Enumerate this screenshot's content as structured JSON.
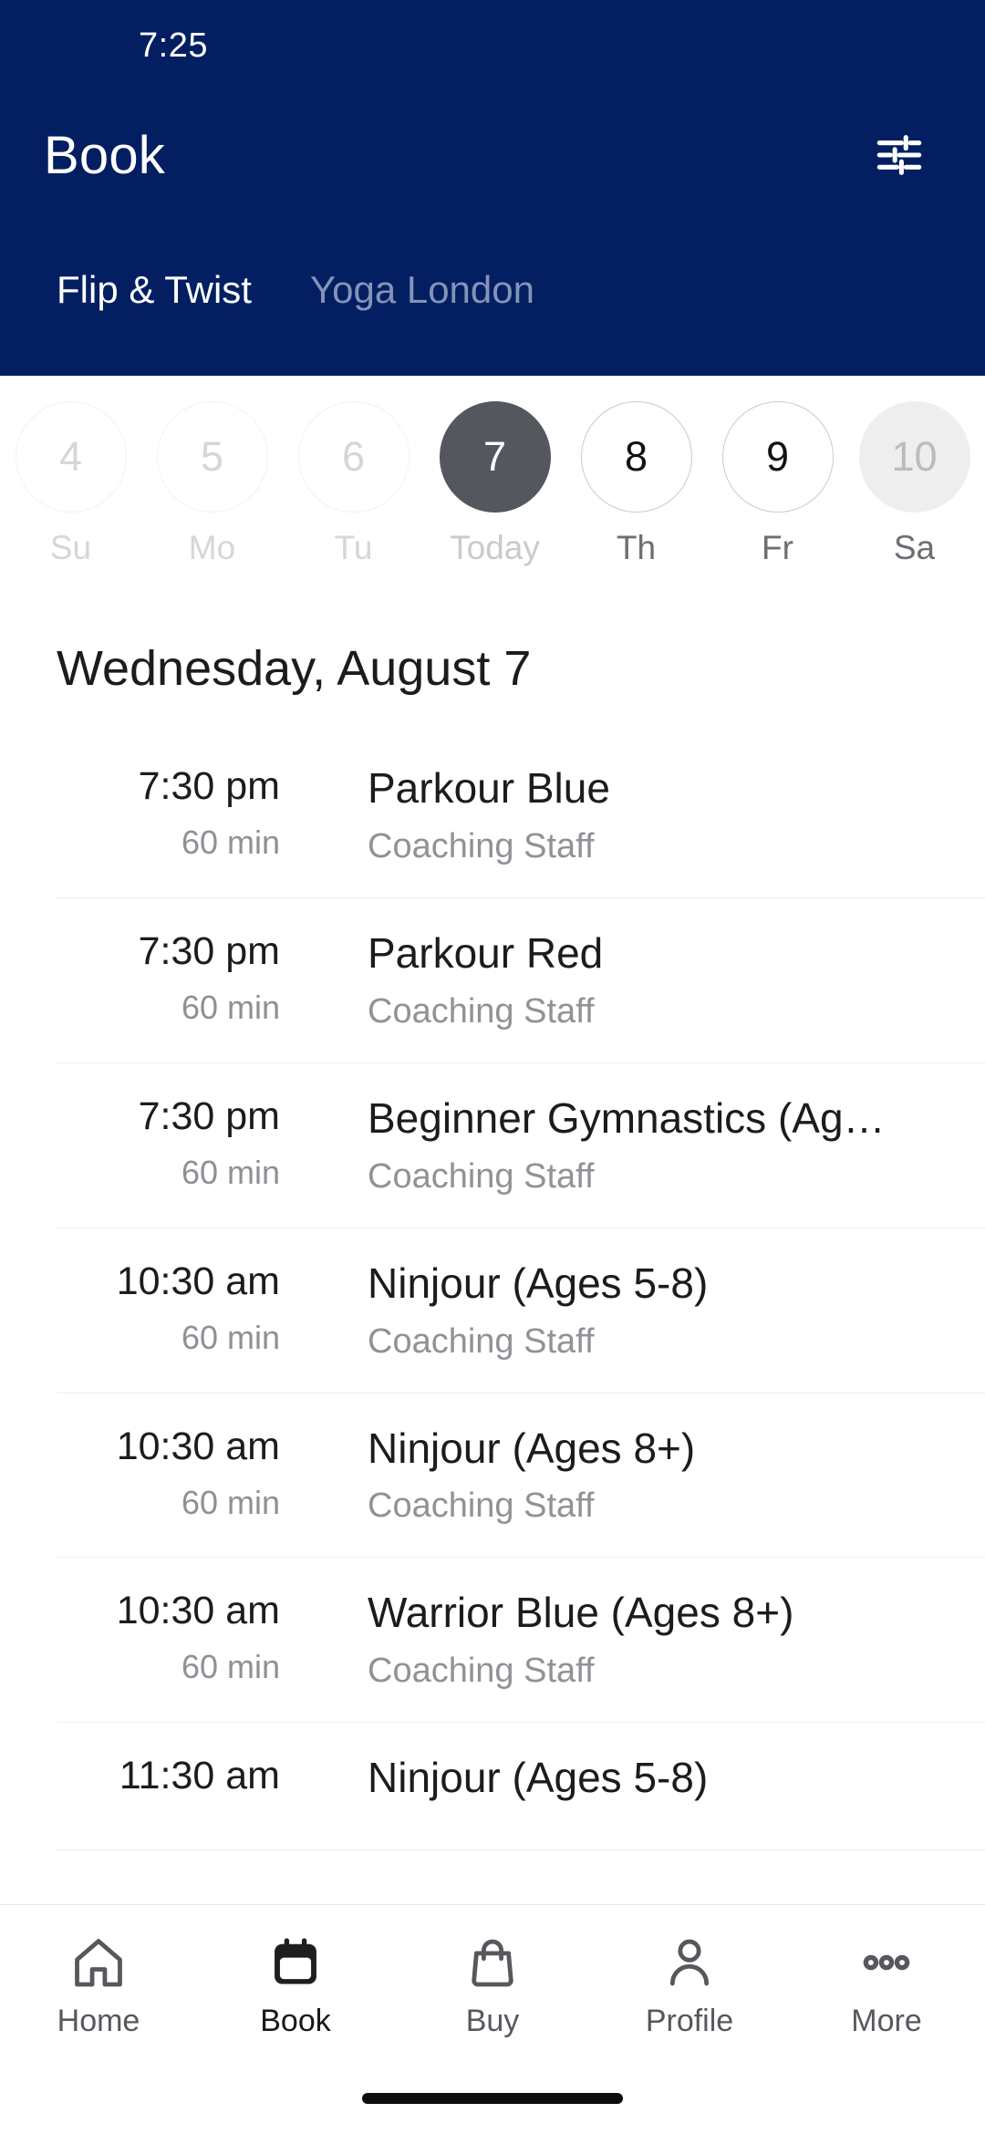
{
  "status_bar": {
    "time": "7:25"
  },
  "header": {
    "title": "Book",
    "filter_icon": "sliders-filter-icon",
    "tabs": [
      {
        "label": "Flip & Twist",
        "active": true
      },
      {
        "label": "Yoga London",
        "active": false
      }
    ],
    "background_color": "#031F62",
    "active_tab_color": "#FFFFFF",
    "inactive_tab_color": "#8493B8"
  },
  "date_strip": {
    "days": [
      {
        "date": "4",
        "weekday": "Su",
        "state": "disabled"
      },
      {
        "date": "5",
        "weekday": "Mo",
        "state": "disabled"
      },
      {
        "date": "6",
        "weekday": "Tu",
        "state": "disabled"
      },
      {
        "date": "7",
        "weekday": "Today",
        "state": "today"
      },
      {
        "date": "8",
        "weekday": "Th",
        "state": "selectable"
      },
      {
        "date": "9",
        "weekday": "Fr",
        "state": "selectable"
      },
      {
        "date": "10",
        "weekday": "Sa",
        "state": "weekend"
      }
    ],
    "today_circle_color": "#55575F",
    "weekend_circle_color": "#EEEEEF"
  },
  "schedule": {
    "date_heading": "Wednesday, August 7",
    "classes": [
      {
        "time": "7:30 pm",
        "duration": "60 min",
        "title": "Parkour Blue",
        "instructor": "Coaching Staff"
      },
      {
        "time": "7:30 pm",
        "duration": "60 min",
        "title": "Parkour Red",
        "instructor": "Coaching Staff"
      },
      {
        "time": "7:30 pm",
        "duration": "60 min",
        "title": "Beginner Gymnastics (Ag…",
        "instructor": "Coaching Staff"
      },
      {
        "time": "10:30 am",
        "duration": "60 min",
        "title": "Ninjour (Ages 5-8)",
        "instructor": "Coaching Staff"
      },
      {
        "time": "10:30 am",
        "duration": "60 min",
        "title": "Ninjour (Ages 8+)",
        "instructor": "Coaching Staff"
      },
      {
        "time": "10:30 am",
        "duration": "60 min",
        "title": "Warrior Blue (Ages 8+)",
        "instructor": "Coaching Staff"
      },
      {
        "time": "11:30 am",
        "duration": "",
        "title": "Ninjour (Ages 5-8)",
        "instructor": ""
      }
    ]
  },
  "bottom_nav": {
    "items": [
      {
        "label": "Home",
        "icon": "home-icon",
        "active": false
      },
      {
        "label": "Book",
        "icon": "calendar-icon",
        "active": true
      },
      {
        "label": "Buy",
        "icon": "bag-icon",
        "active": false
      },
      {
        "label": "Profile",
        "icon": "person-icon",
        "active": false
      },
      {
        "label": "More",
        "icon": "ellipsis-icon",
        "active": false
      }
    ]
  }
}
